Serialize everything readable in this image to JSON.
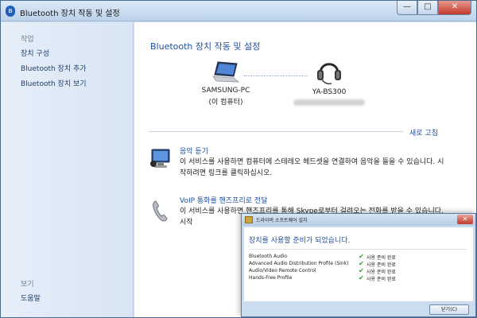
{
  "window": {
    "title": "Bluetooth 장치 작동 및 설정",
    "buttons": {
      "minimize": "—",
      "maximize": "□",
      "close": "✕"
    }
  },
  "sidebar": {
    "section_tasks": "작업",
    "links": [
      "장치 구성",
      "Bluetooth 장치 추가",
      "Bluetooth 장치 보기"
    ],
    "section_see_also": "보기",
    "help": "도움말"
  },
  "main": {
    "heading": "Bluetooth 장치 작동 및 설정",
    "computer": {
      "name": "SAMSUNG-PC",
      "sub": "(이 컴퓨터)"
    },
    "headset": {
      "name": "YA-BS300"
    },
    "refresh": "새로 고침",
    "services": [
      {
        "title": "음악 듣기",
        "desc": "이 서비스를 사용하면 컴퓨터에 스테레오 헤드셋을 연결하여 음악을 들을 수 있습니다. 시작하려면 링크를 클릭하십시오."
      },
      {
        "title": "VoIP 통화를 핸즈프리로 전달",
        "desc": "이 서비스를 사용하면 핸즈프리를 통해 Skype로부터 걸려오는 전화를 받을 수 있습니다. 시작"
      }
    ]
  },
  "dialog": {
    "title": "드라이버 소프트웨어 설치",
    "message": "장치를 사용할 준비가 되었습니다.",
    "items": [
      {
        "name": "Bluetooth Audio",
        "status": "사용 준비 완료"
      },
      {
        "name": "Advanced Audio Distribution Profile (Sink)",
        "status": "사용 준비 완료"
      },
      {
        "name": "Audio/Video Remote Control",
        "status": "사용 준비 완료"
      },
      {
        "name": "Hands-Free Profile",
        "status": "사용 준비 완료"
      }
    ],
    "close_button": "닫기(C)",
    "close_x": "✕"
  },
  "colors": {
    "link": "#1f4f9b",
    "check": "#2d9b2d",
    "titlebar": "#bcd2ea"
  }
}
